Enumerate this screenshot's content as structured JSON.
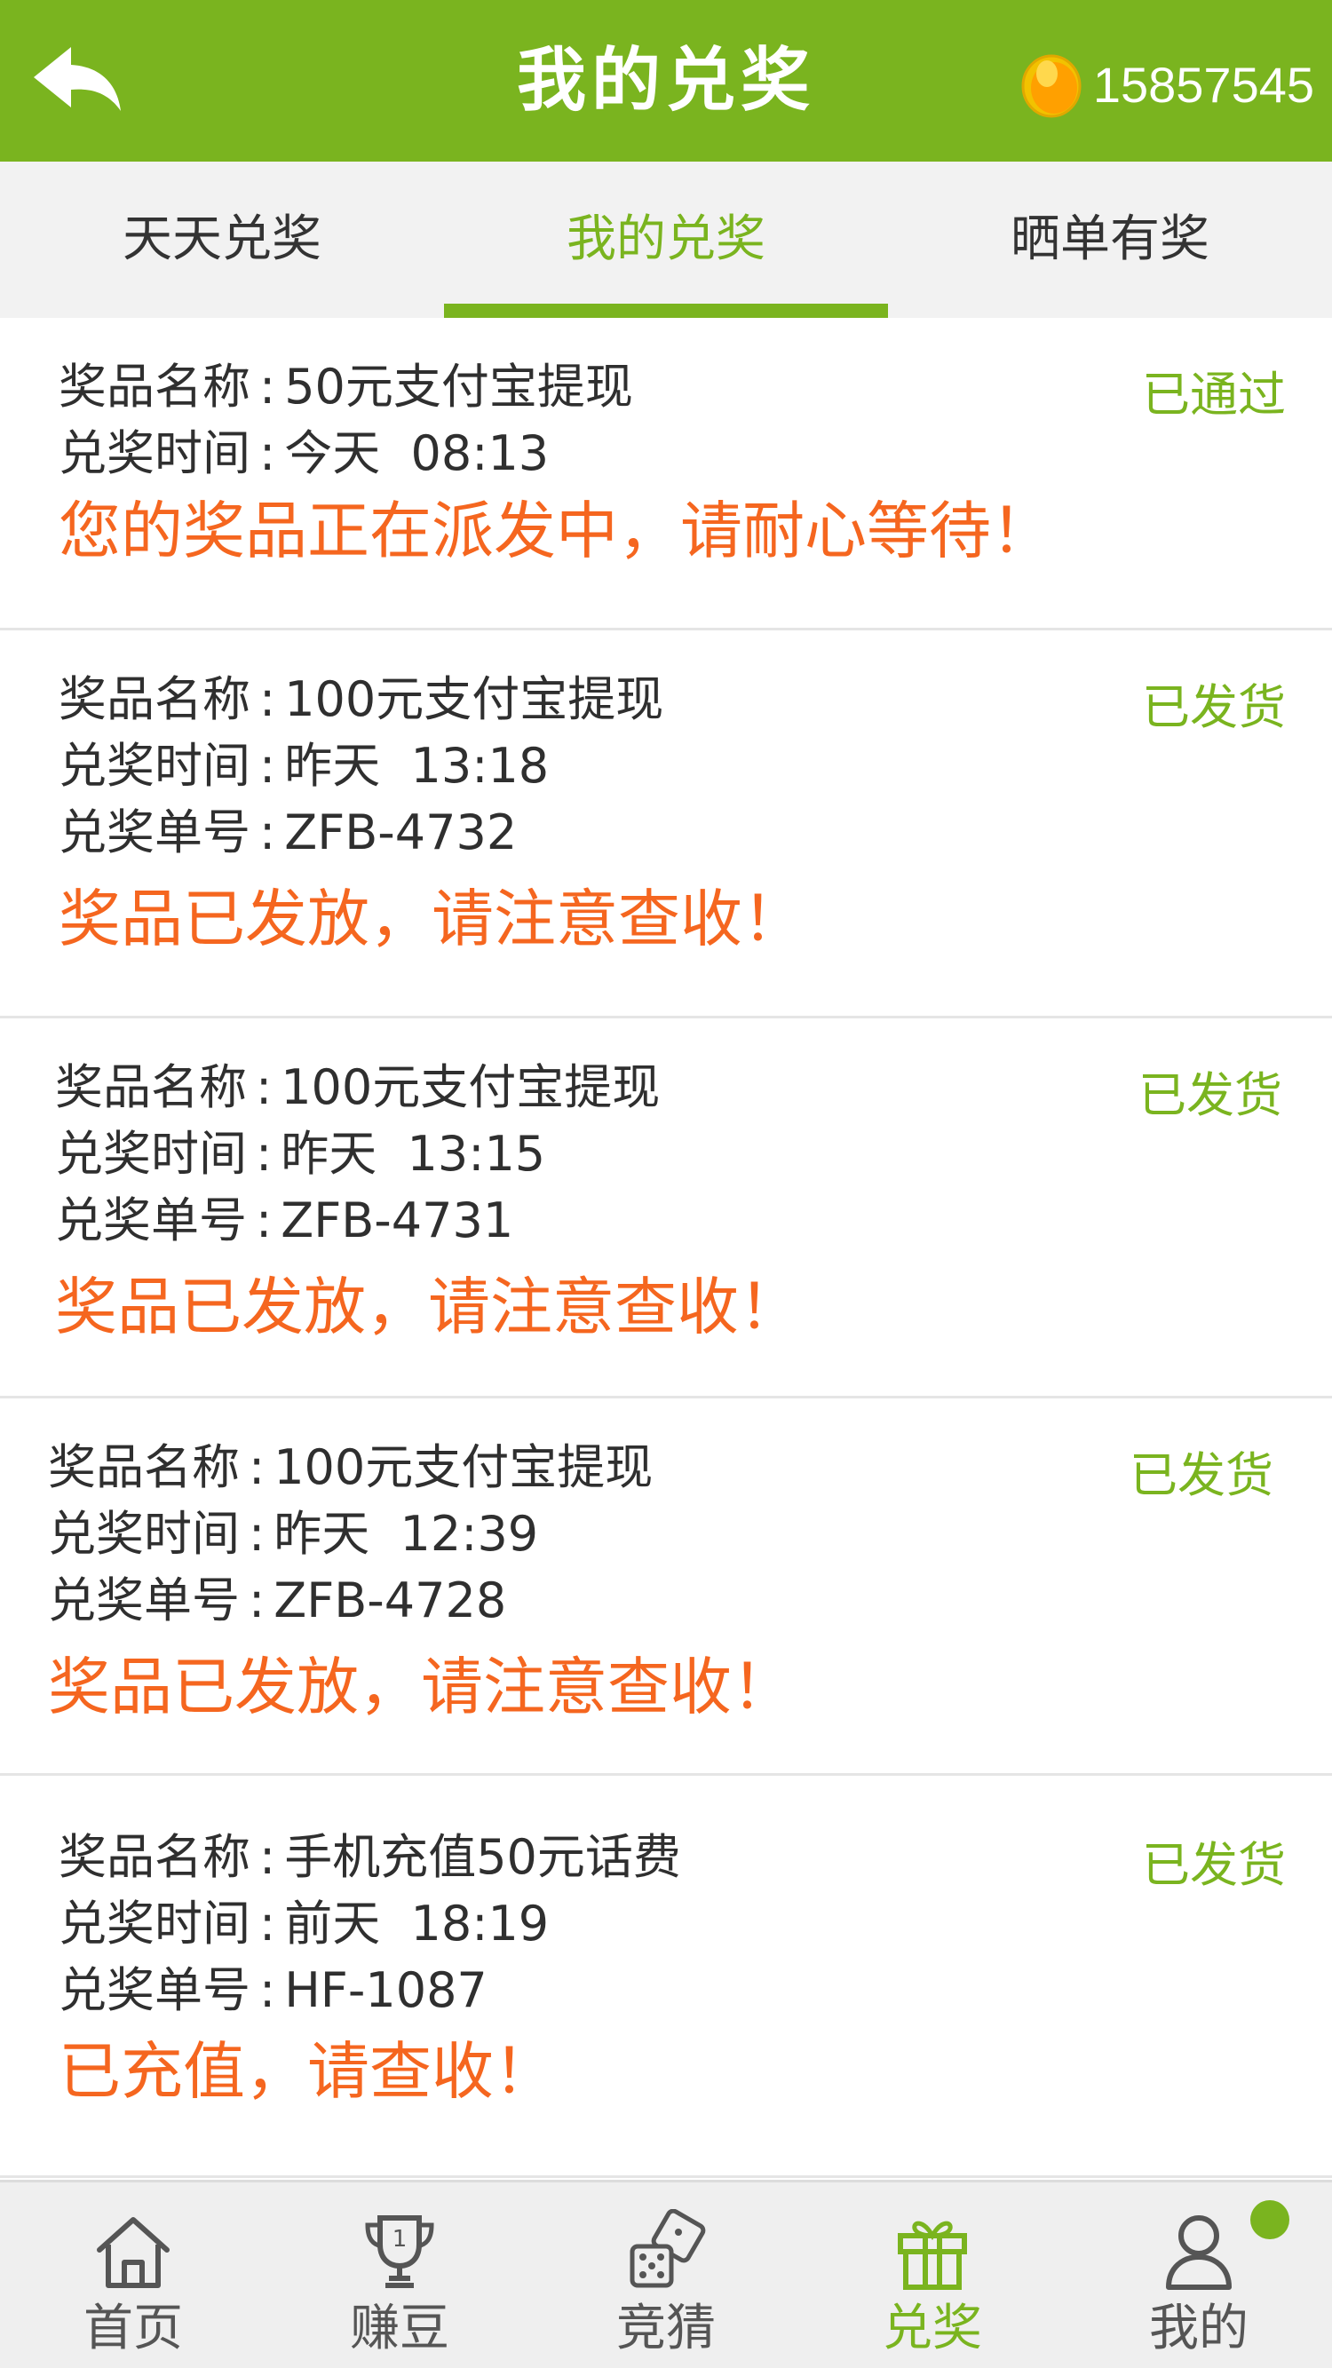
{
  "header": {
    "title": "我的兑奖",
    "coin_count": "15857545",
    "back_icon": "back-arrow-icon",
    "coin_icon": "coin-icon"
  },
  "tabs": [
    {
      "label": "天天兑奖",
      "active": false
    },
    {
      "label": "我的兑奖",
      "active": true
    },
    {
      "label": "晒单有奖",
      "active": false
    }
  ],
  "records": [
    {
      "name_label": "奖品名称",
      "name": "50元支付宝提现",
      "time_label": "兑奖时间",
      "time": "今天  08:13",
      "status": "已通过",
      "message": "您的奖品正在派发中，请耐心等待！"
    },
    {
      "name_label": "奖品名称",
      "name": "100元支付宝提现",
      "time_label": "兑奖时间",
      "time": "昨天  13:18",
      "order_label": "兑奖单号",
      "order": "ZFB-4732",
      "status": "已发货",
      "message": "奖品已发放，请注意查收！"
    },
    {
      "name_label": "奖品名称",
      "name": "100元支付宝提现",
      "time_label": "兑奖时间",
      "time": "昨天  13:15",
      "order_label": "兑奖单号",
      "order": "ZFB-4731",
      "status": "已发货",
      "message": "奖品已发放，请注意查收！"
    },
    {
      "name_label": "奖品名称",
      "name": "100元支付宝提现",
      "time_label": "兑奖时间",
      "time": "昨天  12:39",
      "order_label": "兑奖单号",
      "order": "ZFB-4728",
      "status": "已发货",
      "message": "奖品已发放，请注意查收！"
    },
    {
      "name_label": "奖品名称",
      "name": "手机充值50元话费",
      "time_label": "兑奖时间",
      "time": "前天  18:19",
      "order_label": "兑奖单号",
      "order": "HF-1087",
      "status": "已发货",
      "message": "已充值，请查收！"
    }
  ],
  "bottom_nav": [
    {
      "label": "首页",
      "icon": "home-icon",
      "active": false
    },
    {
      "label": "赚豆",
      "icon": "trophy-icon",
      "active": false
    },
    {
      "label": "竞猜",
      "icon": "dice-icon",
      "active": false
    },
    {
      "label": "兑奖",
      "icon": "gift-icon",
      "active": true
    },
    {
      "label": "我的",
      "icon": "user-icon",
      "active": false,
      "has_dot": true
    }
  ],
  "colors": {
    "brand_green": "#7ab41f",
    "message_orange": "#f5661f",
    "tab_bar_bg": "#f2f2f2",
    "nav_bg": "#efefef"
  }
}
